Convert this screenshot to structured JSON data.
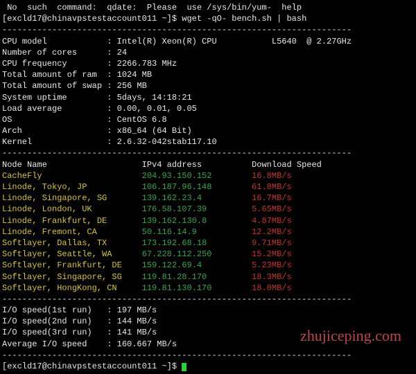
{
  "prompt": {
    "line0_fragment": " No  such  command:  qdate:  Please  use /sys/bin/yum-  help",
    "user_host": "[excld17@chinavpstestaccount011 ~]$",
    "command": "wget -qO- bench.sh | bash"
  },
  "divider": "----------------------------------------------------------------------",
  "sys": [
    {
      "k": "CPU model            ",
      "v": "Intel(R) Xeon(R) CPU           L5640  @ 2.27GHz"
    },
    {
      "k": "Number of cores      ",
      "v": "24"
    },
    {
      "k": "CPU frequency        ",
      "v": "2266.783 MHz"
    },
    {
      "k": "Total amount of ram  ",
      "v": "1024 MB"
    },
    {
      "k": "Total amount of swap ",
      "v": "256 MB"
    },
    {
      "k": "System uptime        ",
      "v": "5days, 14:18:21"
    },
    {
      "k": "Load average         ",
      "v": "0.00, 0.01, 0.05"
    },
    {
      "k": "OS                   ",
      "v": "CentOS 6.8"
    },
    {
      "k": "Arch                 ",
      "v": "x86_64 (64 Bit)"
    },
    {
      "k": "Kernel               ",
      "v": "2.6.32-042stab117.10"
    }
  ],
  "table_header": {
    "name": "Node Name",
    "ip": "IPv4 address",
    "speed": "Download Speed"
  },
  "nodes": [
    {
      "name": "CacheFly",
      "ip": "204.93.150.152",
      "speed": "16.8MB/s"
    },
    {
      "name": "Linode, Tokyo, JP",
      "ip": "106.187.96.148",
      "speed": "61.8MB/s"
    },
    {
      "name": "Linode, Singapore, SG",
      "ip": "139.162.23.4",
      "speed": "16.7MB/s"
    },
    {
      "name": "Linode, London, UK",
      "ip": "176.58.107.39",
      "speed": "5.65MB/s"
    },
    {
      "name": "Linode, Frankfurt, DE",
      "ip": "139.162.130.8",
      "speed": "4.87MB/s"
    },
    {
      "name": "Linode, Fremont, CA",
      "ip": "50.116.14.9",
      "speed": "12.2MB/s"
    },
    {
      "name": "Softlayer, Dallas, TX",
      "ip": "173.192.68.18",
      "speed": "9.71MB/s"
    },
    {
      "name": "Softlayer, Seattle, WA",
      "ip": "67.228.112.250",
      "speed": "15.2MB/s"
    },
    {
      "name": "Softlayer, Frankfurt, DE",
      "ip": "159.122.69.4",
      "speed": "5.23MB/s"
    },
    {
      "name": "Softlayer, Singapore, SG",
      "ip": "119.81.28.170",
      "speed": "18.3MB/s"
    },
    {
      "name": "Softlayer, HongKong, CN",
      "ip": "119.81.130.170",
      "speed": "18.0MB/s"
    }
  ],
  "io": [
    {
      "k": "I/O speed(1st run)   ",
      "v": "197 MB/s"
    },
    {
      "k": "I/O speed(2nd run)   ",
      "v": "144 MB/s"
    },
    {
      "k": "I/O speed(3rd run)   ",
      "v": "141 MB/s"
    },
    {
      "k": "Average I/O speed    ",
      "v": "160.667 MB/s"
    }
  ],
  "watermark": "zhujiceping.com"
}
